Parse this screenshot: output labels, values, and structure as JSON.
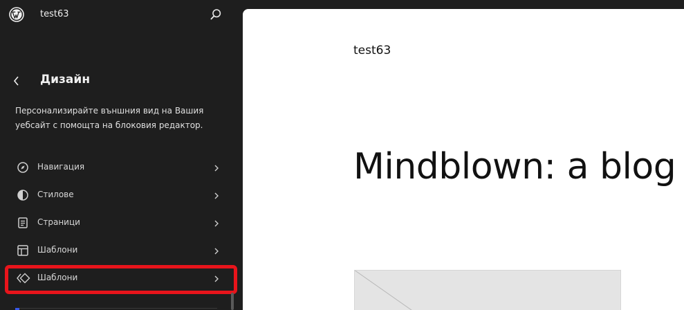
{
  "topbar": {
    "site_name": "test63",
    "logo_icon": "wordpress-logo-icon",
    "search_icon": "search-icon"
  },
  "section": {
    "title": "Дизайн",
    "description": "Персонализирайте външния вид на Вашия уебсайт с помощта на блоковия редактор."
  },
  "nav": {
    "items": [
      {
        "label": "Навигация",
        "icon": "navigation-compass-icon"
      },
      {
        "label": "Стилове",
        "icon": "styles-half-circle-icon"
      },
      {
        "label": "Страници",
        "icon": "page-icon"
      },
      {
        "label": "Шаблони",
        "icon": "layout-template-icon"
      },
      {
        "label": "Шаблони",
        "icon": "patterns-diamond-icon"
      }
    ]
  },
  "preview": {
    "site_title": "test63",
    "heading": "Mindblown: a blog"
  },
  "colors": {
    "sidebar_bg": "#1e1e1e",
    "highlight": "#e8141b",
    "canvas_bg": "#ffffff",
    "accent": "#3858e9"
  }
}
